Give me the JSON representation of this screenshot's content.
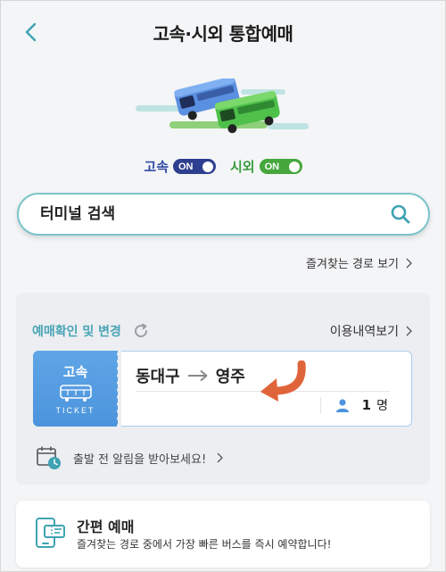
{
  "header": {
    "title": "고속·시외 통합예매",
    "back_icon": "chevron-left-icon"
  },
  "toggles": {
    "express_label": "고속",
    "express_state": "ON",
    "intercity_label": "시외",
    "intercity_state": "ON"
  },
  "search": {
    "placeholder": "터미널 검색"
  },
  "favorite_routes_link": "즐겨찾는 경로 보기",
  "reservation": {
    "title": "예매확인 및 변경",
    "history_link": "이용내역보기",
    "ticket": {
      "type": "고속",
      "ticket_word": "TICKET",
      "from": "동대구",
      "to": "영주",
      "passenger_count": "1",
      "passenger_unit": "명"
    },
    "alert_text": "출발 전 알림을 받아보세요!"
  },
  "easy_booking": {
    "title": "간편 예매",
    "description": "즐겨찾는 경로 중에서 가장 빠른 버스를 즉시 예약합니다!"
  },
  "colors": {
    "accent_teal": "#4aa4b6",
    "express_blue": "#2e3f8f",
    "intercity_green": "#45a73c",
    "ticket_blue": "#5fa5e6",
    "arrow_orange": "#e0643a"
  }
}
